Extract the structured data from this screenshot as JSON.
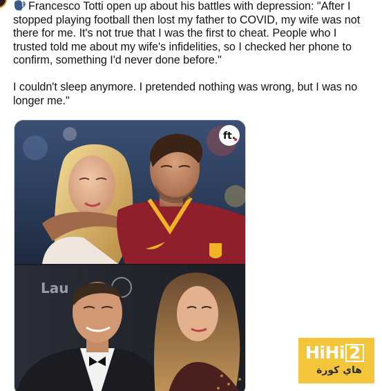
{
  "tweet": {
    "paragraph_1": "Francesco Totti open up about his battles with depression: \"After I stopped playing football then lost my father to COVID, my wife was not there for me. It's not true that I was the first to cheat. People who I trusted told me about my wife's infidelities, so I checked her phone to confirm, something I'd never done before.\"",
    "paragraph_2": "I couldn't sleep anymore. I pretended nothing was wrong, but I was no longer me.\"",
    "emoji": "speaking-head-emoji"
  },
  "media": {
    "badge_text": "ft.",
    "top_photo": "couple-in-roma-stadium",
    "bottom_photo": "couple-at-laureus-awards",
    "backdrop_text": "Lau",
    "shirt_sponsor": "nike-swoosh"
  },
  "watermark": {
    "latin": "HiHi",
    "latin_boxed": "2",
    "arabic": "هاي كورة",
    "background": "#f3c53a"
  },
  "colors": {
    "text": "#0f1419",
    "roma_red": "#8e1f2b",
    "roma_yellow": "#f0b323"
  }
}
